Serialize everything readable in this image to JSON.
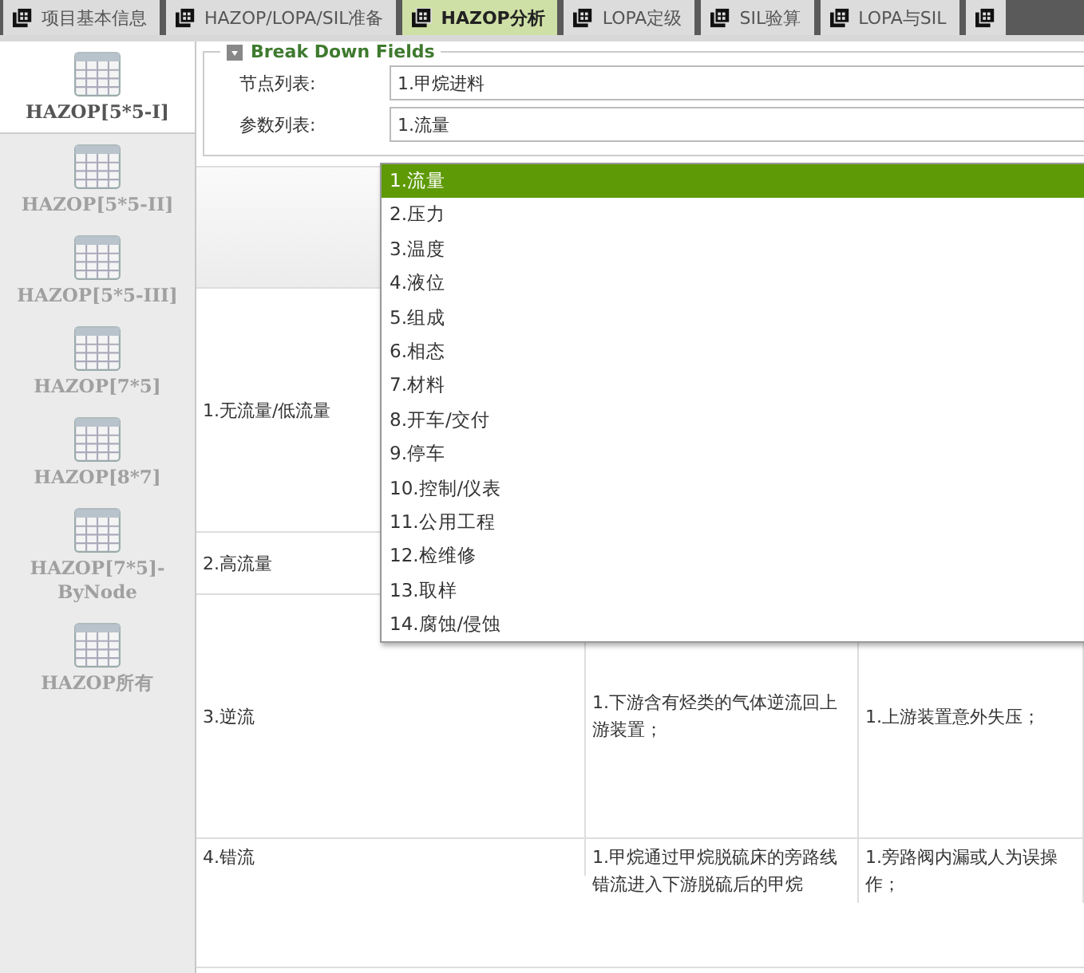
{
  "tabs": [
    {
      "label": "项目基本信息",
      "selected": false
    },
    {
      "label": "HAZOP/LOPA/SIL准备",
      "selected": false
    },
    {
      "label": "HAZOP分析",
      "selected": true
    },
    {
      "label": "LOPA定级",
      "selected": false
    },
    {
      "label": "SIL验算",
      "selected": false
    },
    {
      "label": "LOPA与SIL",
      "selected": false
    }
  ],
  "sidebar": {
    "items": [
      {
        "label": "HAZOP[5*5-I]",
        "selected": true
      },
      {
        "label": "HAZOP[5*5-II]",
        "selected": false
      },
      {
        "label": "HAZOP[5*5-III]",
        "selected": false
      },
      {
        "label": "HAZOP[7*5]",
        "selected": false
      },
      {
        "label": "HAZOP[8*7]",
        "selected": false
      },
      {
        "label": "HAZOP[7*5]-ByNode",
        "selected": false
      },
      {
        "label": "HAZOP所有",
        "selected": false
      }
    ]
  },
  "fieldset": {
    "legend": "Break Down Fields",
    "fields": [
      {
        "label": "节点列表:",
        "value": "1.甲烷进料"
      },
      {
        "label": "参数列表:",
        "value": "1.流量"
      }
    ]
  },
  "dropdown": {
    "options": [
      {
        "label": "1.流量",
        "selected": true
      },
      {
        "label": "2.压力",
        "selected": false
      },
      {
        "label": "3.温度",
        "selected": false
      },
      {
        "label": "4.液位",
        "selected": false
      },
      {
        "label": "5.组成",
        "selected": false
      },
      {
        "label": "6.相态",
        "selected": false
      },
      {
        "label": "7.材料",
        "selected": false
      },
      {
        "label": "8.开车/交付",
        "selected": false
      },
      {
        "label": "9.停车",
        "selected": false
      },
      {
        "label": "10.控制/仪表",
        "selected": false
      },
      {
        "label": "11.公用工程",
        "selected": false
      },
      {
        "label": "12.检维修",
        "selected": false
      },
      {
        "label": "13.取样",
        "selected": false
      },
      {
        "label": "14.腐蚀/侵蚀",
        "selected": false
      }
    ]
  },
  "table": {
    "rows": [
      {
        "deviation": "1.无流量/低流量"
      },
      {
        "deviation": "2.高流量"
      },
      {
        "deviation": "3.逆流",
        "cause": "1.下游含有烃类的气体逆流回上游装置；",
        "consequence": "1.上游装置意外失压；"
      },
      {
        "deviation": "4.错流",
        "cause": "1.甲烷通过甲烷脱硫床的旁路线错流进入下游脱硫后的甲烷",
        "consequence": "1.旁路阀内漏或人为误操作；"
      }
    ]
  }
}
